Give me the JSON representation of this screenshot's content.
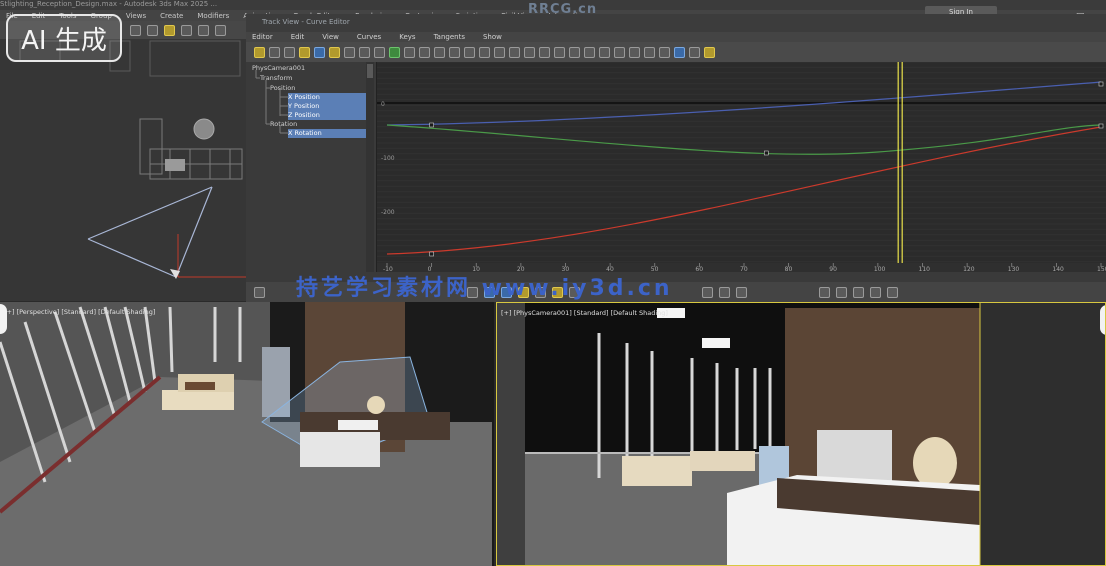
{
  "app": {
    "title_text": "Stlighting_Reception_Design.max - Autodesk 3ds Max 2025 ..."
  },
  "menubar": [
    "File",
    "Edit",
    "Tools",
    "Group",
    "Views",
    "Create",
    "Modifiers",
    "Animation",
    "Graph Editors",
    "Rendering",
    "Customize",
    "Scripting",
    "Civil View",
    "Interactive",
    "Arnold",
    "Help"
  ],
  "sign_in_label": "Sign In",
  "window_controls": "— □ ✕",
  "watermark": {
    "ai_badge": "AI 生成",
    "rrcg": "RRCG.cn",
    "site": "持艺学习素材网 www.iy3d.cn"
  },
  "curve_editor": {
    "title": "Track View - Curve Editor",
    "menu": [
      "Editor",
      "Edit",
      "View",
      "Curves",
      "Keys",
      "Tangents",
      "Show"
    ],
    "tree": [
      {
        "label": "PhysCamera001",
        "selected": false
      },
      {
        "label": "Transform",
        "selected": false
      },
      {
        "label": "Position",
        "selected": false
      },
      {
        "label": "X Position",
        "selected": true
      },
      {
        "label": "Y Position",
        "selected": true
      },
      {
        "label": "Z Position",
        "selected": true
      },
      {
        "label": "Rotation",
        "selected": false
      },
      {
        "label": "X Rotation",
        "selected": true
      }
    ],
    "y_ticks": [
      "0",
      "-100",
      "-200"
    ],
    "x_ticks": [
      "-10",
      "0",
      "10",
      "20",
      "30",
      "40",
      "50",
      "60",
      "70",
      "80",
      "90",
      "100",
      "110",
      "120",
      "130",
      "140",
      "150"
    ],
    "current_frame": 105
  },
  "viewports": {
    "perspective_label": "[+] [Perspective] [Standard] [Default Shading]",
    "camera_label": "[+] [PhysCamera001] [Standard] [Default Shading]"
  },
  "colors": {
    "curve_x": "#cc3a2c",
    "curve_y": "#4a9a48",
    "curve_z": "#4a5fb0",
    "time_slider": "#e8e04a",
    "selection": "#5b7fb6"
  }
}
